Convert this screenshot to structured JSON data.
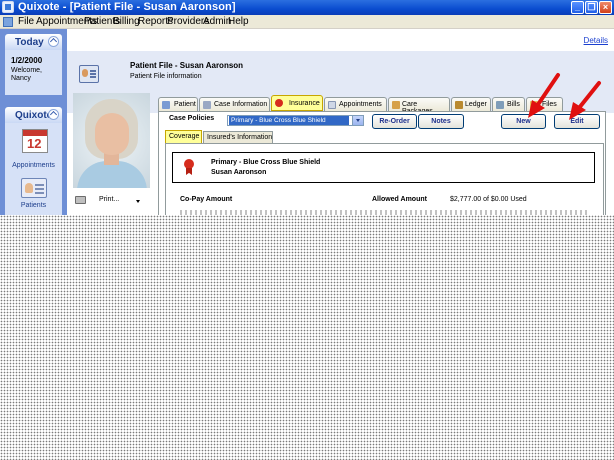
{
  "window": {
    "title": "Quixote - [Patient File - Susan Aaronson]",
    "buttons": [
      "minimize",
      "restore",
      "close"
    ]
  },
  "menu": {
    "items": [
      "File",
      "Appointments",
      "Patients",
      "Billing",
      "Reports",
      "Providers",
      "Admin",
      "Help"
    ]
  },
  "sidebar": {
    "today": {
      "header": "Today",
      "date": "1/2/2000",
      "welcome": "Welcome,",
      "user": "Nancy"
    },
    "quixote": {
      "header": "Quixote",
      "calendar_number": "12",
      "items": [
        {
          "label": "Appointments",
          "icon": "calendar-icon"
        },
        {
          "label": "Patients",
          "icon": "patient-file-icon"
        }
      ]
    }
  },
  "header": {
    "details_link": "Details",
    "title": "Patient File - Susan Aaronson",
    "subtitle": "Patient File information"
  },
  "photo_panel": {
    "print_label": "Print..."
  },
  "tabs": [
    {
      "label": "Patient",
      "icon": "patient-icon"
    },
    {
      "label": "Case Information",
      "icon": "case-icon"
    },
    {
      "label": "Insurance",
      "icon": "ribbon-icon",
      "active": true
    },
    {
      "label": "Appointments",
      "icon": "calendar-icon"
    },
    {
      "label": "Care Packages",
      "icon": "package-icon"
    },
    {
      "label": "Ledger",
      "icon": "ledger-icon"
    },
    {
      "label": "Bills",
      "icon": "bills-icon"
    },
    {
      "label": "Files",
      "icon": "files-icon"
    }
  ],
  "insurance": {
    "case_policies_label": "Case Policies",
    "case_policy_selected": "Primary - Blue Cross Blue Shield",
    "buttons": {
      "reorder": "Re-Order",
      "notes": "Notes",
      "new": "New",
      "edit": "Edit"
    },
    "subtabs": [
      {
        "label": "Coverage",
        "active": true
      },
      {
        "label": "Insured's Information"
      }
    ],
    "policy": {
      "name": "Primary - Blue Cross Blue Shield",
      "holder": "Susan Aaronson"
    },
    "copay_label": "Co-Pay Amount",
    "allowed_label": "Allowed Amount",
    "allowed_value": "$2,777.00 of $0.00 Used"
  },
  "colors": {
    "titlebar": "#0a4ccf",
    "sidebar": "#6e8fd6",
    "header_band": "#e3e9f6",
    "highlight": "#ffff99",
    "annotation_arrow": "#e01010"
  }
}
